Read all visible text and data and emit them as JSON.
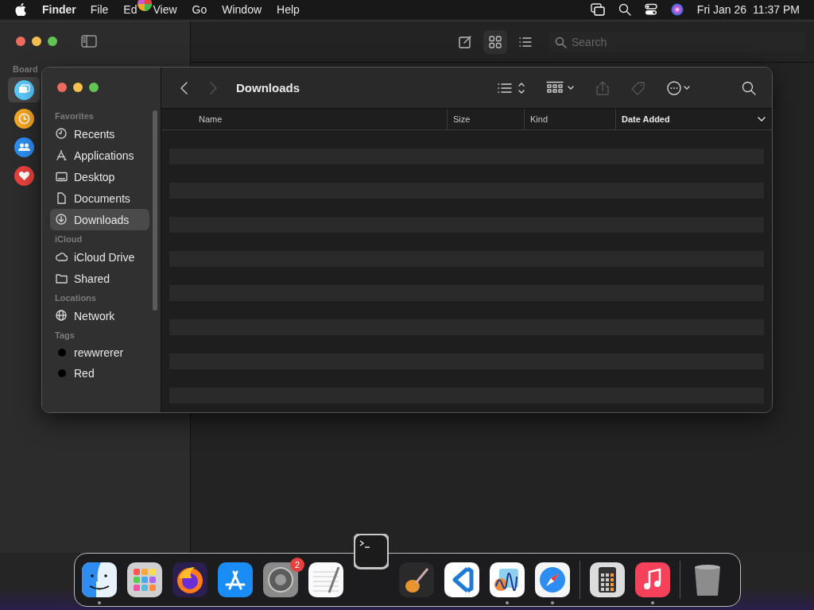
{
  "menu_bar": {
    "app": "Finder",
    "menus": [
      "File",
      "Ed",
      "View",
      "Go",
      "Window",
      "Help"
    ],
    "date": "Fri Jan 26",
    "time": "11:37 PM"
  },
  "back_window": {
    "sidebar_heading": "Board",
    "sidebar_items": [
      {
        "color": "#5ac8fa",
        "selected": true
      },
      {
        "color": "#f5a623",
        "selected": false
      },
      {
        "color": "#2d8cf0",
        "selected": false
      },
      {
        "color": "#e5413e",
        "selected": false
      }
    ],
    "view_buttons": [
      {
        "kind": "compose",
        "selected": false
      },
      {
        "kind": "grid",
        "selected": true
      },
      {
        "kind": "list",
        "selected": false
      }
    ],
    "search": {
      "placeholder": "Search"
    }
  },
  "finder": {
    "title": "Downloads",
    "back_disabled": false,
    "forward_disabled": true,
    "share_disabled": true,
    "tag_disabled": true,
    "sidebar": [
      {
        "kind": "heading",
        "label": "Favorites"
      },
      {
        "kind": "item",
        "label": "Recents",
        "selected": false
      },
      {
        "kind": "item",
        "label": "Applications",
        "selected": false
      },
      {
        "kind": "item",
        "label": "Desktop",
        "selected": false
      },
      {
        "kind": "item",
        "label": "Documents",
        "selected": false
      },
      {
        "kind": "item",
        "label": "Downloads",
        "selected": true
      },
      {
        "kind": "heading",
        "label": "iCloud"
      },
      {
        "kind": "item",
        "label": "iCloud Drive",
        "selected": false
      },
      {
        "kind": "item",
        "label": "Shared",
        "selected": false
      },
      {
        "kind": "heading",
        "label": "Locations"
      },
      {
        "kind": "item",
        "label": "Network",
        "selected": false
      },
      {
        "kind": "heading",
        "label": "Tags"
      },
      {
        "kind": "tag",
        "label": "rewwrerer",
        "color": "#000000"
      },
      {
        "kind": "tag",
        "label": "Red",
        "color": "#000000"
      }
    ],
    "columns": [
      {
        "label": "Name",
        "sorted": false
      },
      {
        "label": "Size",
        "sorted": false
      },
      {
        "label": "Kind",
        "sorted": false
      },
      {
        "label": "Date Added",
        "sorted": true
      }
    ]
  },
  "dock": [
    {
      "running": true
    },
    {
      "running": false
    },
    {
      "running": false
    },
    {
      "running": false
    },
    {
      "running": false,
      "badge": "2"
    },
    {
      "running": false
    },
    {
      "running": false,
      "dragging": true
    },
    {
      "running": false
    },
    {
      "running": false
    },
    {
      "running": true
    },
    {
      "running": true
    },
    {
      "kind": "separator"
    },
    {
      "running": false
    },
    {
      "running": true
    },
    {
      "kind": "separator"
    },
    {
      "running": false
    }
  ]
}
